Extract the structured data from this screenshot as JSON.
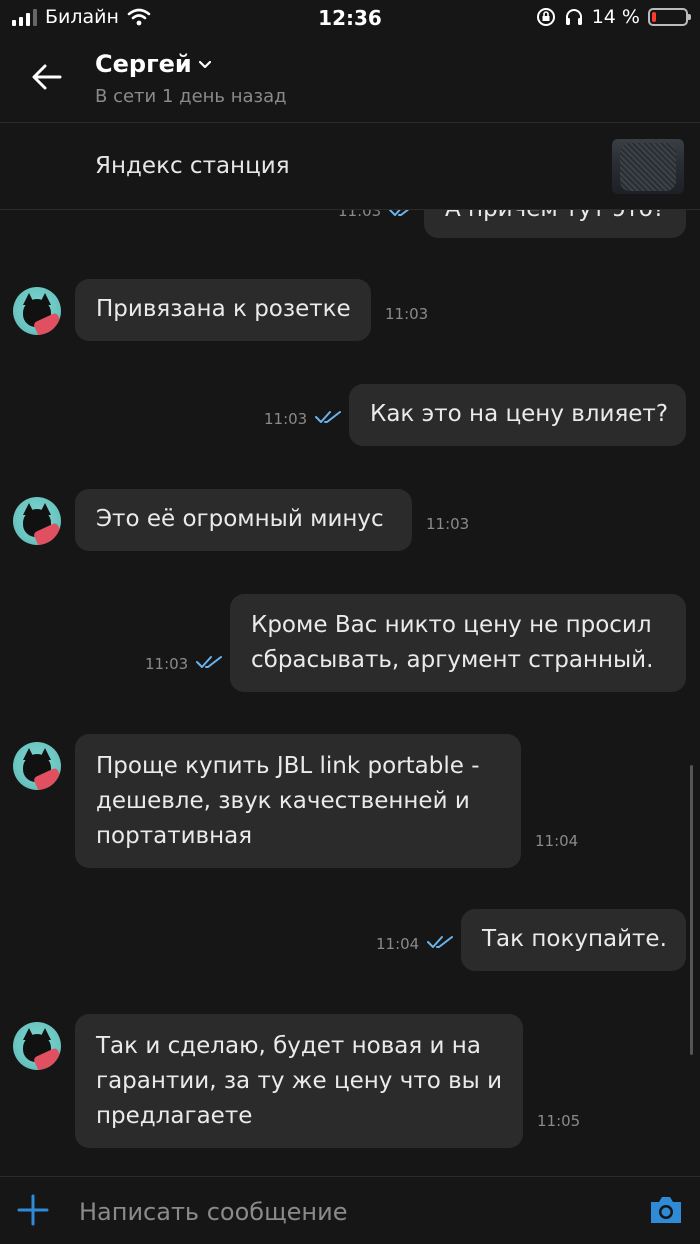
{
  "status_bar": {
    "carrier": "Билайн",
    "time": "12:36",
    "battery_text": "14 %",
    "battery_level": 0.14,
    "battery_color": "#ff3b30"
  },
  "header": {
    "name": "Сергей",
    "presence": "В сети 1 день назад"
  },
  "banner": {
    "title": "Яндекс станция"
  },
  "messages": [
    {
      "side": "out",
      "text": "А причем тут это?",
      "time": "11:03",
      "partial": true
    },
    {
      "side": "in",
      "text": "Привязана к розетке",
      "time": "11:03"
    },
    {
      "side": "out",
      "text": "Как это на цену влияет?",
      "time": "11:03"
    },
    {
      "side": "in",
      "text": "Это её огромный минус",
      "time": "11:03"
    },
    {
      "side": "out",
      "lines": [
        "Кроме Вас никто цену не просил",
        "сбрасывать, аргумент странный."
      ],
      "time": "11:03"
    },
    {
      "side": "in",
      "lines": [
        "Проще купить JBL link portable -",
        "дешевле, звук качественней и",
        "портативная"
      ],
      "time": "11:04"
    },
    {
      "side": "out",
      "text": "Так покупайте.",
      "time": "11:04"
    },
    {
      "side": "in",
      "lines": [
        "Так и сделаю, будет новая и на",
        "гарантии, за ту же цену что вы и",
        "предлагаете"
      ],
      "time": "11:05"
    }
  ],
  "composer": {
    "placeholder": "Написать сообщение"
  },
  "colors": {
    "background": "#161616",
    "bubble": "#2b2b2b",
    "accent": "#2f8bd8",
    "read_ticks": "#6ab4ec"
  },
  "icons": [
    "back-arrow-icon",
    "chevron-down-icon",
    "double-check-icon",
    "plus-icon",
    "camera-icon",
    "wifi-icon",
    "lock-rotation-icon",
    "headphones-icon",
    "battery-icon",
    "signal-icon"
  ]
}
